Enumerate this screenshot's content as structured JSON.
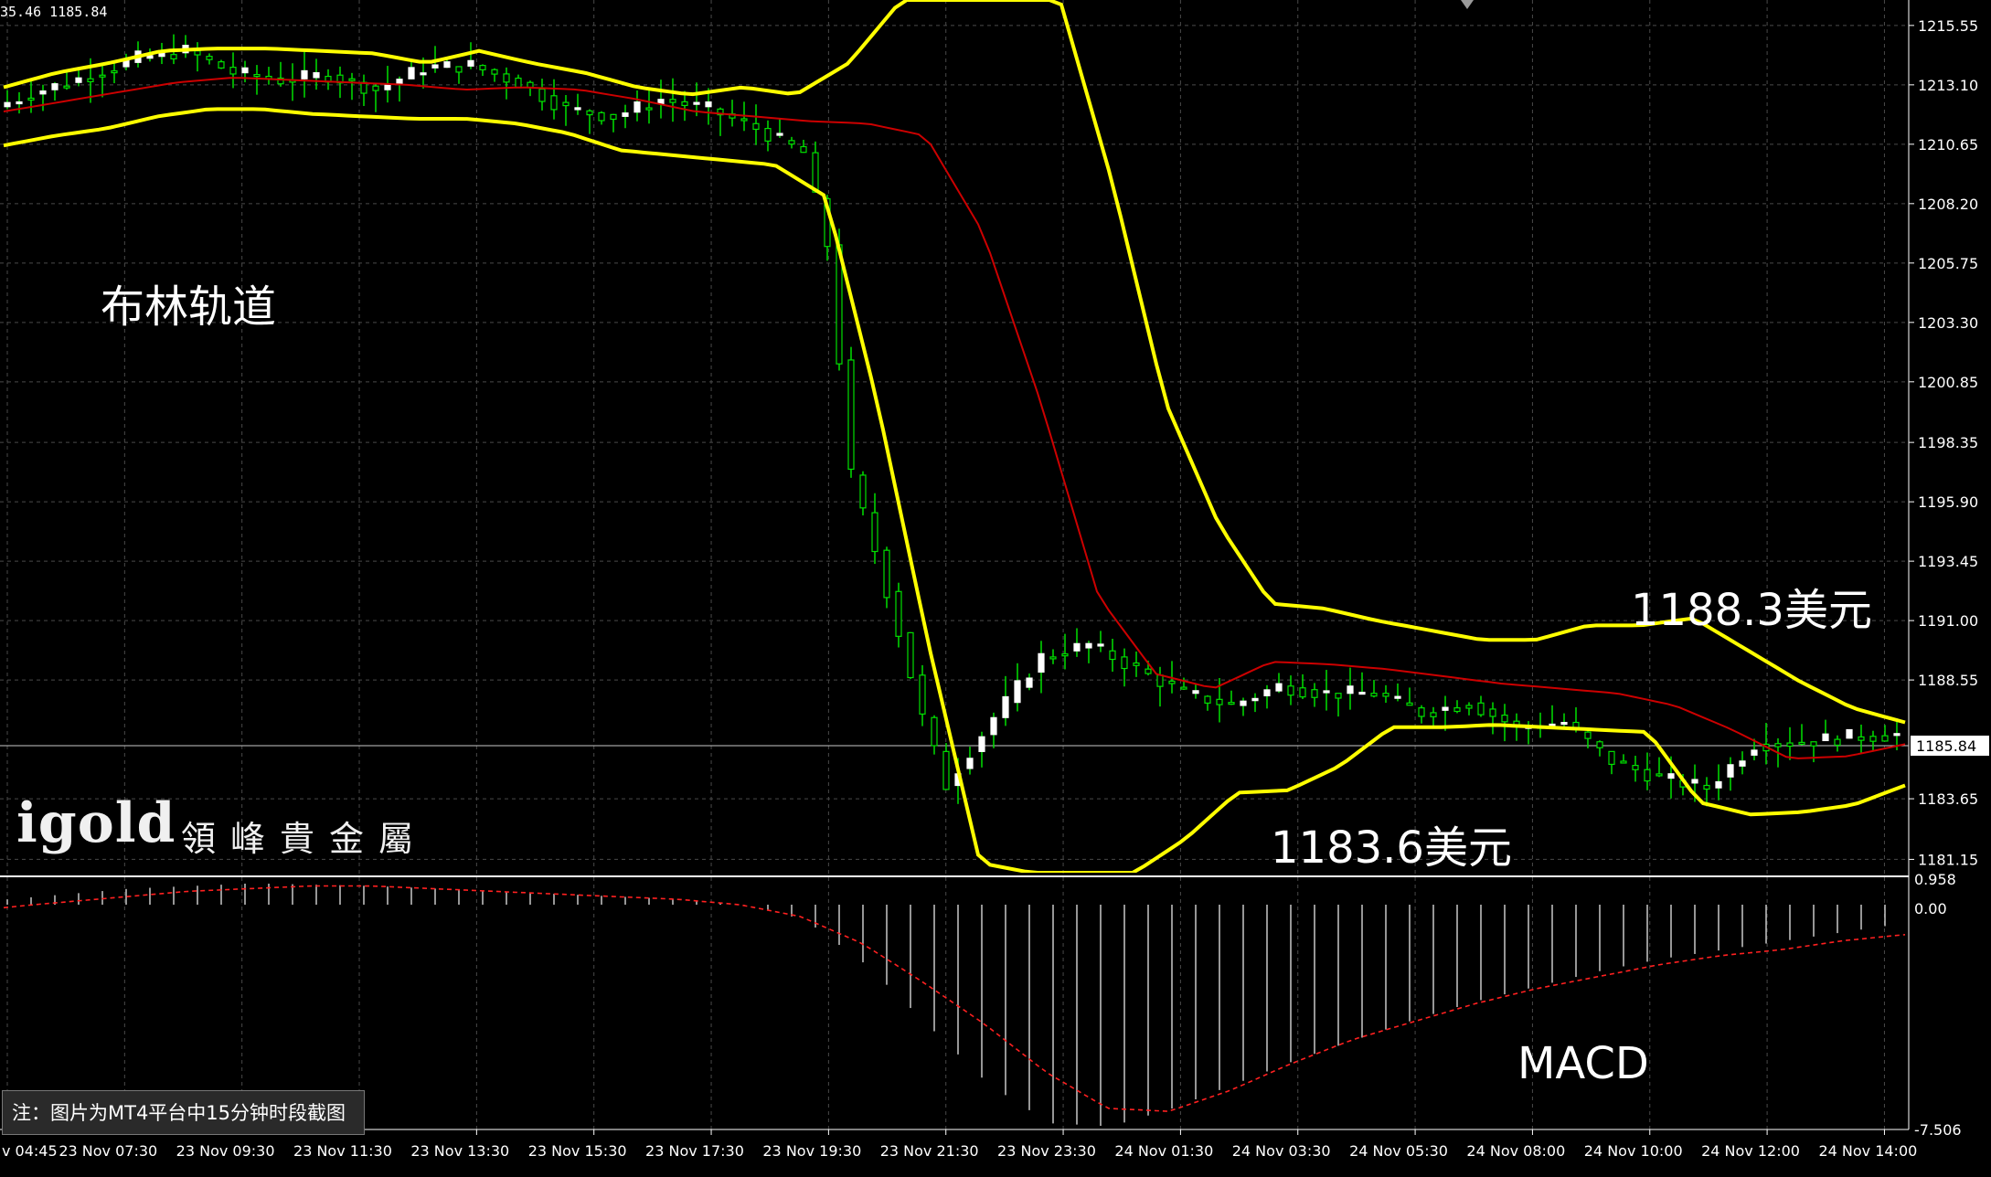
{
  "header": {
    "text": "35.46 1185.84"
  },
  "annotations": {
    "bollinger_label": "布林轨道",
    "upper_value": "1188.3美元",
    "lower_value": "1183.6美元",
    "macd_label": "MACD"
  },
  "logo": {
    "text": "igold",
    "subtitle": "領峰貴金屬"
  },
  "note": "注：图片为MT4平台中15分钟时段截图",
  "price_axis": {
    "ticks": [
      "1215.55",
      "1213.10",
      "1210.65",
      "1208.20",
      "1205.75",
      "1203.30",
      "1200.85",
      "1198.35",
      "1195.90",
      "1193.45",
      "1191.00",
      "1188.55",
      "1183.65",
      "1181.15"
    ],
    "current_price": "1185.84"
  },
  "macd_axis": {
    "ticks": [
      "0.958",
      "0.00",
      "-7.506"
    ]
  },
  "time_axis": {
    "labels": [
      "v 04:45",
      "23 Nov 07:30",
      "23 Nov 09:30",
      "23 Nov 11:30",
      "23 Nov 13:30",
      "23 Nov 15:30",
      "23 Nov 17:30",
      "23 Nov 19:30",
      "23 Nov 21:30",
      "23 Nov 23:30",
      "24 Nov 01:30",
      "24 Nov 03:30",
      "24 Nov 05:30",
      "24 Nov 08:00",
      "24 Nov 10:00",
      "24 Nov 12:00",
      "24 Nov 14:00"
    ]
  },
  "colors": {
    "background": "#000000",
    "grid": "#4a4a4a",
    "bull_candle": "#ffffff",
    "bear_candle": "#00e000",
    "wick": "#00e000",
    "bollinger": "#ffff00",
    "middle_ma": "#cc0000",
    "macd_hist": "#c8c8c8",
    "macd_signal": "#ff2020"
  },
  "chart_data": {
    "type": "candlestick",
    "symbol_timeframe": "M15",
    "ylim": [
      1180.6,
      1216.6
    ],
    "macd_ylim": [
      -7.506,
      0.958
    ],
    "series": [
      {
        "name": "price_close",
        "x": [
          0,
          4,
          8,
          12,
          16,
          20,
          24,
          28,
          32,
          36,
          40,
          44,
          48,
          52,
          56,
          60,
          64,
          68,
          70,
          72,
          74,
          76,
          78,
          80,
          84,
          88,
          92,
          96,
          100,
          104,
          108,
          112,
          116,
          120,
          124,
          128,
          132,
          136,
          140,
          144,
          148,
          152,
          156,
          160
        ],
        "values": [
          1212.2,
          1212.9,
          1213.5,
          1214.2,
          1214.5,
          1213.6,
          1213.3,
          1213.5,
          1212.9,
          1213.8,
          1213.9,
          1213.2,
          1212.1,
          1211.8,
          1212.5,
          1212.1,
          1211.3,
          1210.3,
          1206.5,
          1197.0,
          1193.9,
          1190.5,
          1187.0,
          1184.2,
          1187.0,
          1189.5,
          1190.0,
          1189.0,
          1188.0,
          1187.5,
          1188.3,
          1188.0,
          1188.0,
          1187.2,
          1187.6,
          1186.6,
          1186.8,
          1185.2,
          1184.5,
          1184.1,
          1185.9,
          1186.0,
          1186.2,
          1186.3
        ]
      },
      {
        "name": "bollinger_upper",
        "values": [
          1213.0,
          1213.6,
          1214.0,
          1214.5,
          1214.6,
          1214.6,
          1214.5,
          1214.4,
          1214.0,
          1214.5,
          1214.0,
          1213.6,
          1213.0,
          1212.7,
          1213.0,
          1212.7,
          1214.0,
          1216.6,
          1216.6,
          1216.6,
          1216.6,
          1209.0,
          1200.0,
          1195.0,
          1191.7,
          1191.5,
          1191.0,
          1190.6,
          1190.2,
          1190.2,
          1190.8,
          1190.8,
          1191.1,
          1189.8,
          1188.5,
          1187.4,
          1186.8
        ]
      },
      {
        "name": "bollinger_lower",
        "values": [
          1210.6,
          1211.0,
          1211.3,
          1211.8,
          1212.1,
          1212.1,
          1211.9,
          1211.8,
          1211.7,
          1211.7,
          1211.5,
          1211.1,
          1210.4,
          1210.2,
          1210.0,
          1209.8,
          1208.5,
          1200.0,
          1190.0,
          1181.0,
          1180.6,
          1180.6,
          1180.6,
          1182.0,
          1183.9,
          1184.0,
          1185.0,
          1186.6,
          1186.6,
          1186.7,
          1186.6,
          1186.5,
          1186.4,
          1183.5,
          1183.0,
          1183.1,
          1183.4,
          1184.2
        ]
      },
      {
        "name": "middle_ma",
        "values": [
          1212.0,
          1212.4,
          1212.8,
          1213.2,
          1213.4,
          1213.3,
          1213.2,
          1213.1,
          1212.9,
          1213.0,
          1212.9,
          1212.5,
          1212.0,
          1211.8,
          1211.6,
          1211.5,
          1211.0,
          1207.0,
          1200.0,
          1192.0,
          1188.8,
          1188.2,
          1189.3,
          1189.2,
          1189.0,
          1188.7,
          1188.4,
          1188.2,
          1188.0,
          1187.5,
          1186.5,
          1185.3,
          1185.4,
          1185.9
        ]
      },
      {
        "name": "macd_histogram",
        "values": [
          0.2,
          0.4,
          0.6,
          0.7,
          0.8,
          0.75,
          0.7,
          0.6,
          0.5,
          0.4,
          0.3,
          0.2,
          0.0,
          -0.5,
          -2.0,
          -4.0,
          -6.0,
          -7.3,
          -7.4,
          -6.8,
          -6.0,
          -5.2,
          -4.5,
          -3.8,
          -3.2,
          -2.7,
          -2.2,
          -1.8,
          -1.5,
          -1.2,
          -0.9,
          -0.6
        ]
      },
      {
        "name": "macd_signal",
        "values": [
          -0.1,
          0.1,
          0.3,
          0.5,
          0.6,
          0.7,
          0.7,
          0.6,
          0.5,
          0.4,
          0.3,
          0.2,
          0.0,
          -0.4,
          -1.3,
          -2.6,
          -4.0,
          -5.6,
          -6.8,
          -6.9,
          -6.2,
          -5.3,
          -4.5,
          -3.9,
          -3.3,
          -2.8,
          -2.4,
          -2.0,
          -1.7,
          -1.5,
          -1.2,
          -1.0
        ]
      }
    ],
    "hlines": [
      {
        "value": 1185.84,
        "label": "1185.84"
      }
    ],
    "grid": true
  }
}
